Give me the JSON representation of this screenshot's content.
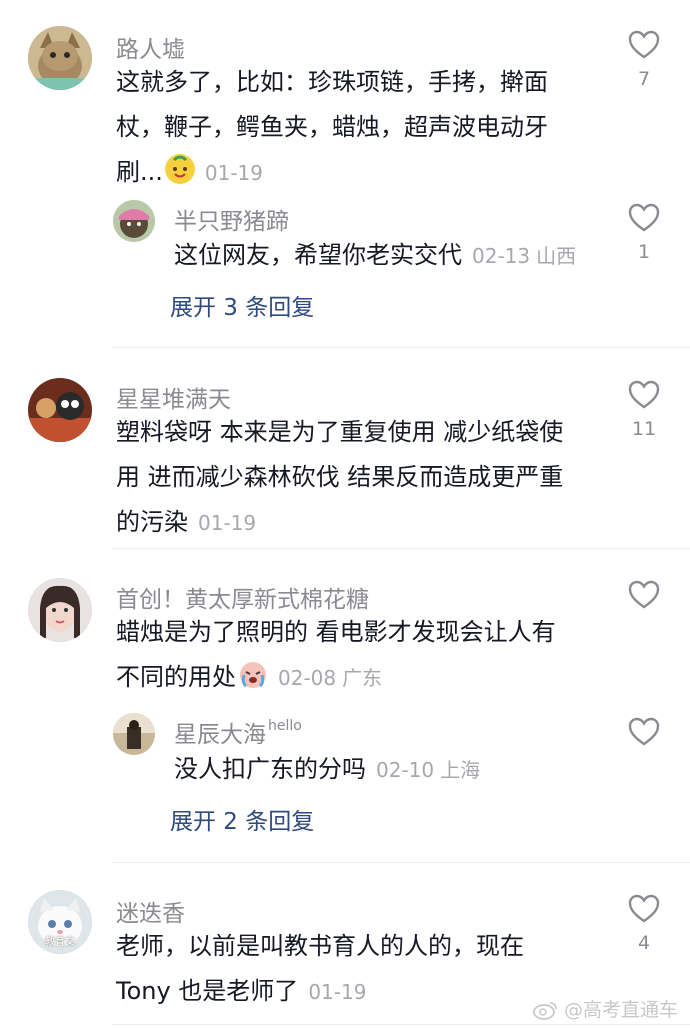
{
  "comments": [
    {
      "author": "路人墟",
      "text_lines": [
        "这就多了，比如：珍珠项链，手拷，擀面",
        "杖，鞭子，鳄鱼夹，蜡烛，超声波电动牙",
        "刷..."
      ],
      "date": "01-19",
      "likes": "7",
      "emoji": "smiling-face-emoji",
      "reply": {
        "author": "半只野猪蹄",
        "text": "这位网友，希望你老实交代",
        "date": "02-13",
        "location": "山西",
        "likes": "1"
      },
      "expand_label": "展开 3 条回复"
    },
    {
      "author": "星星堆满天",
      "text_lines": [
        "塑料袋呀 本来是为了重复使用 减少纸袋使",
        "用 进而减少森林砍伐 结果反而造成更严重",
        "的污染"
      ],
      "date": "01-19",
      "likes": "11"
    },
    {
      "author": "首创！黄太厚新式棉花糖",
      "text_lines": [
        "蜡烛是为了照明的 看电影才发现会让人有",
        "不同的用处"
      ],
      "date": "02-08",
      "location": "广东",
      "likes": "",
      "emoji": "crying-face-emoji",
      "reply": {
        "author": "星辰大海",
        "author_suffix": "hello",
        "text": "没人扣广东的分吗",
        "date": "02-10",
        "location": "上海",
        "likes": ""
      },
      "expand_label": "展开 2 条回复"
    },
    {
      "author": "迷迭香",
      "text_lines": [
        "老师，以前是叫教书育人的人的，现在",
        "Tony 也是老师了"
      ],
      "date": "01-19",
      "likes": "4",
      "avatar_caption": "教育文"
    }
  ],
  "watermark": "@高考直通车",
  "icons": {
    "like": "heart-outline-icon",
    "watermark": "weibo-icon"
  }
}
